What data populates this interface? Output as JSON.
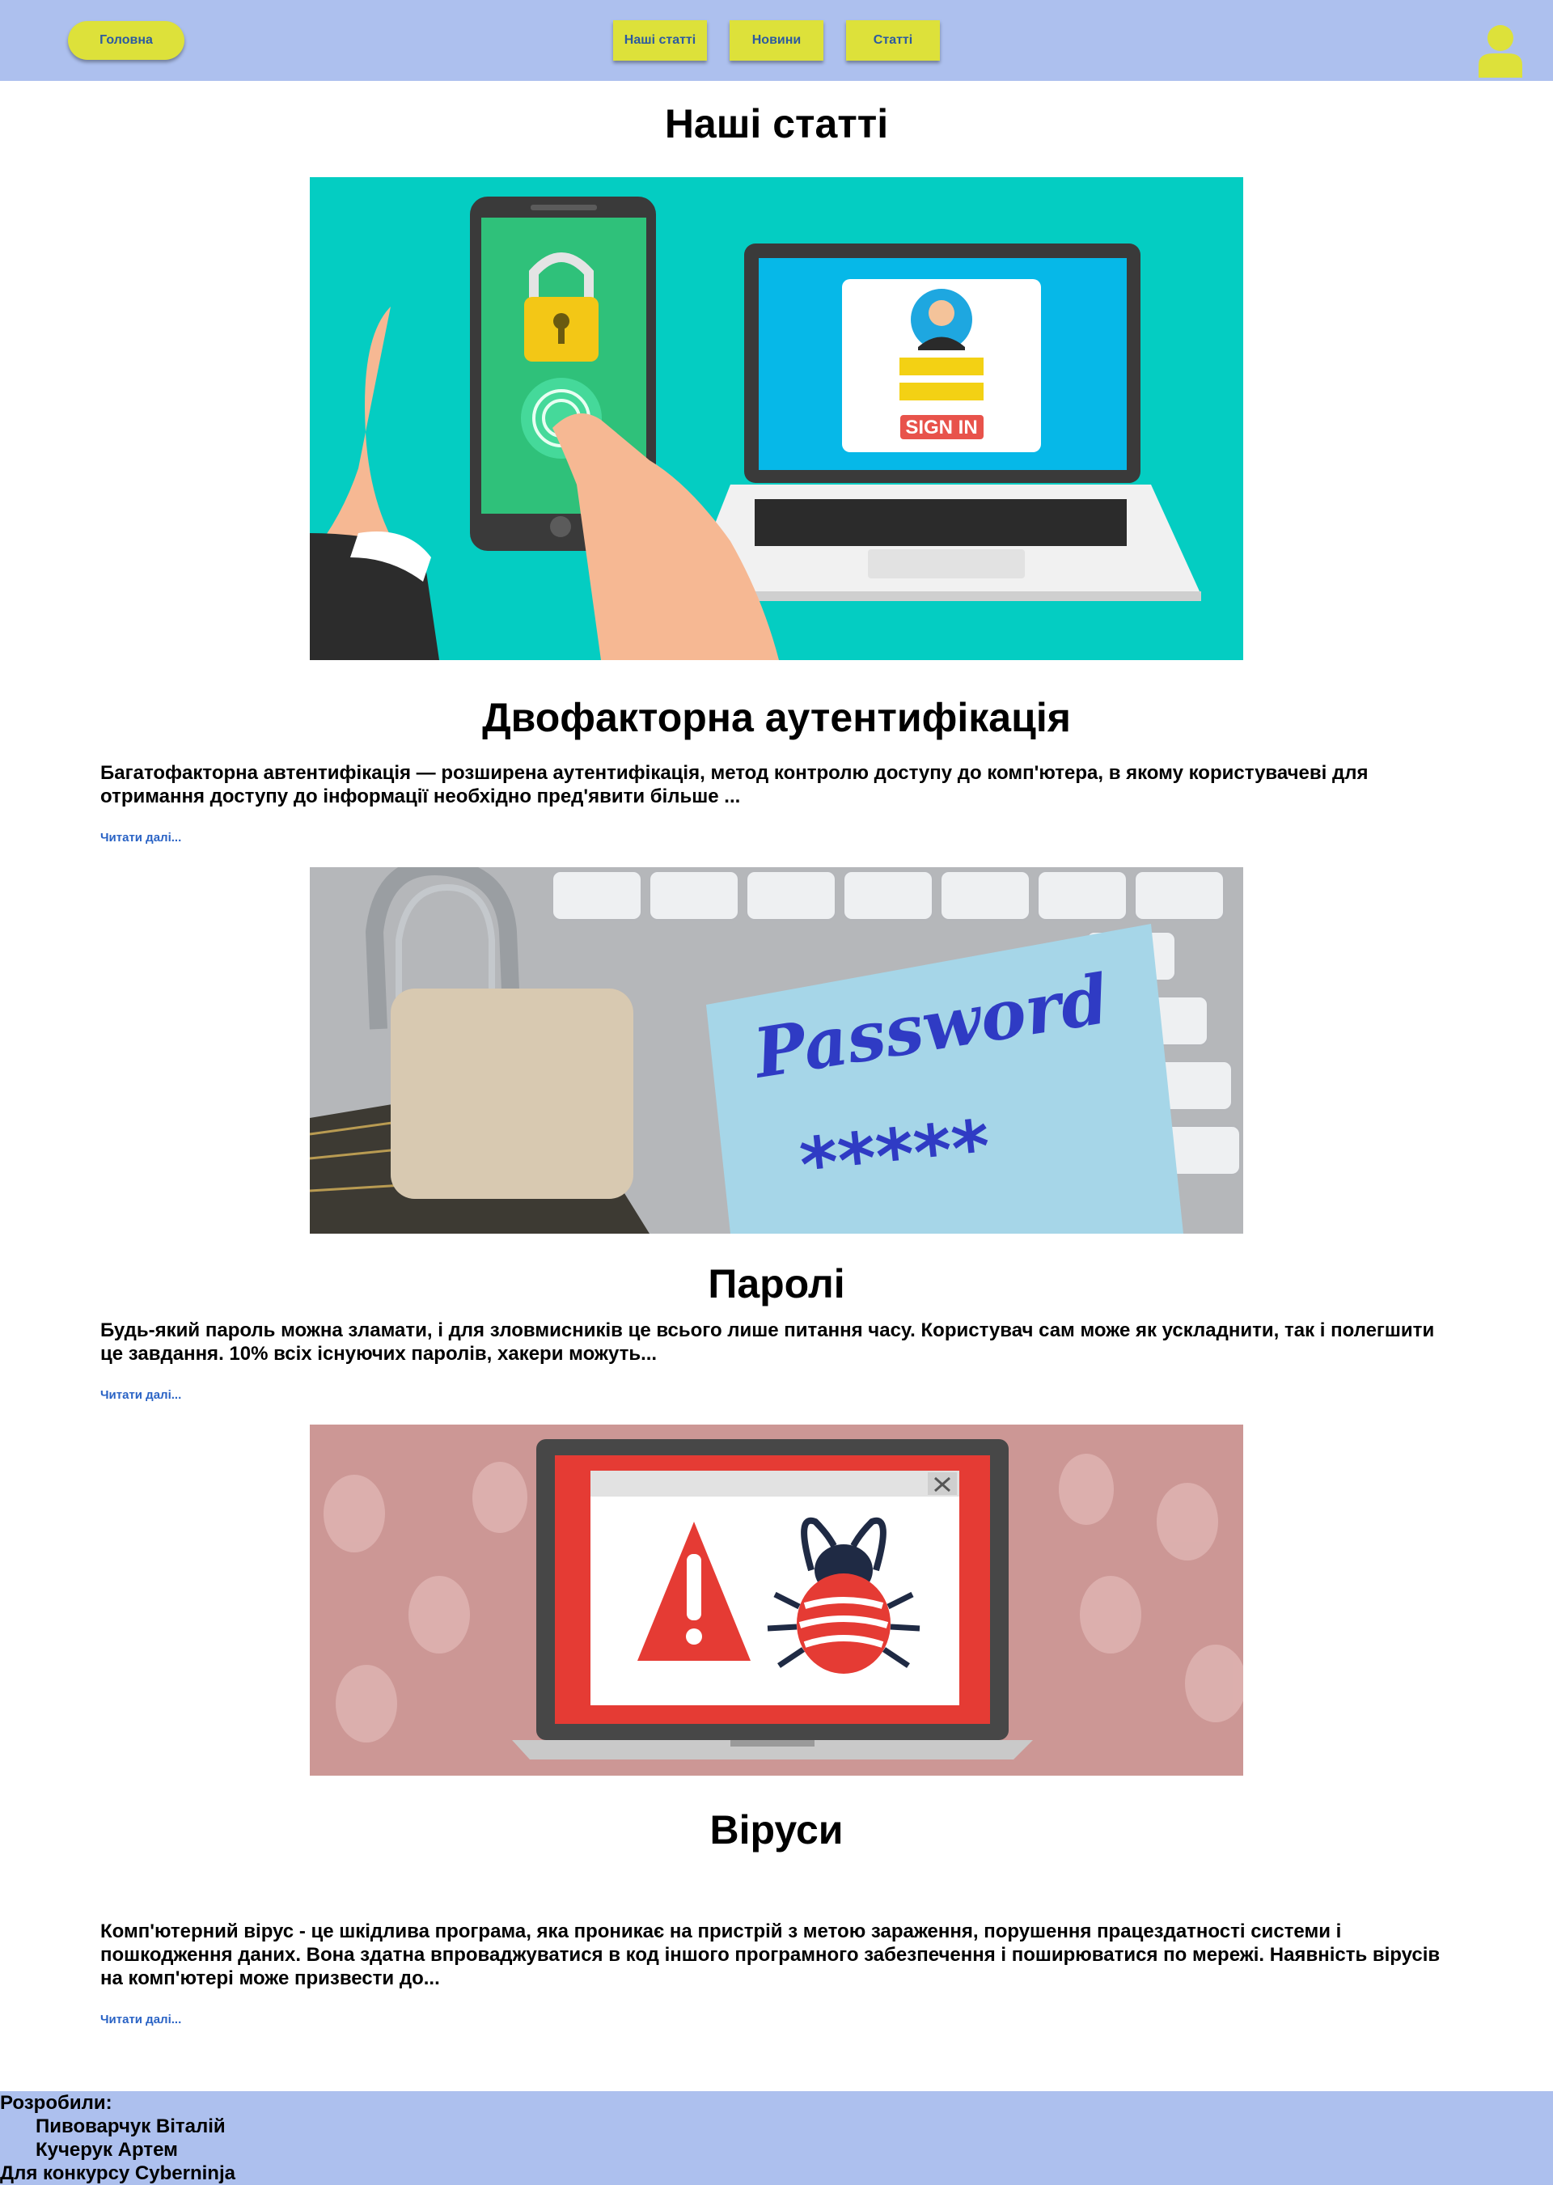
{
  "header": {
    "home_label": "Головна",
    "nav": [
      "Наші статті",
      "Новини",
      "Статті"
    ]
  },
  "page_title": "Наші статті",
  "articles": [
    {
      "title": "Двофакторна аутентифікація",
      "text": "Багатофакторна автентифікація — розширена аутентифікація, метод контролю доступу до комп'ютера, в якому користувачеві для отримання доступу до інформації необхідно пред'явити більше ...",
      "read_more": "Читати далі...",
      "image_text": "SIGN IN"
    },
    {
      "title": "Паролі",
      "text": "Будь-який пароль можна зламати, і для зловмисників це всього лише питання часу. Користувач сам може як ускладнити, так і полегшити це завдання. 10% всіх існуючих паролів, хакери можуть...",
      "read_more": "Читати далі...",
      "image_text": "Password",
      "image_text_2": "*****"
    },
    {
      "title": "Віруси",
      "text": "Комп'ютерний вірус - це шкідлива програма, яка проникає на пристрій з метою зараження, порушення працездатності системи і пошкодження даних. Вона здатна впроваджуватися в код іншого програмного забезпечення і поширюватися по мережі. Наявність вірусів на комп'ютері може призвести до...",
      "read_more": "Читати далі..."
    }
  ],
  "footer": {
    "developed_by": "Розробили:",
    "authors": [
      "Пивоварчук Віталій",
      "Кучерук Артем"
    ],
    "contest": "Для конкурсу Cyberninja"
  },
  "colors": {
    "header_bg": "#adc0ee",
    "button_bg": "#dde13a",
    "link": "#2a63c5"
  },
  "icons": {
    "user": "user-icon"
  }
}
